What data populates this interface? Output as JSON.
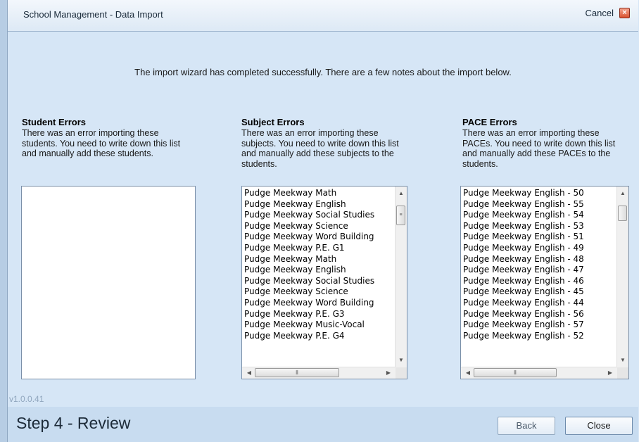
{
  "window": {
    "title": "School Management - Data Import",
    "cancel_label": "Cancel"
  },
  "message": "The import wizard has completed successfully. There are a few notes about the import below.",
  "student_errors": {
    "title": "Student Errors",
    "description": "There was an error importing these students. You need to write down this list and manually add these students.",
    "items": []
  },
  "subject_errors": {
    "title": "Subject Errors",
    "description": "There was an error importing these subjects. You need to write down this list and manually add these subjects to the students.",
    "items": [
      "Pudge Meekway Math",
      "Pudge Meekway English",
      "Pudge Meekway Social Studies",
      "Pudge Meekway Science",
      "Pudge Meekway Word Building",
      "Pudge Meekway P.E. G1",
      "Pudge Meekway Math",
      "Pudge Meekway English",
      "Pudge Meekway Social Studies",
      "Pudge Meekway Science",
      "Pudge Meekway Word Building",
      "Pudge Meekway P.E. G3",
      "Pudge Meekway Music-Vocal",
      "Pudge Meekway P.E. G4"
    ]
  },
  "pace_errors": {
    "title": "PACE Errors",
    "description": "There was an error importing these PACEs. You need to write down this list and manually add these PACEs to the students.",
    "items": [
      "Pudge Meekway English - 50",
      "Pudge Meekway English - 55",
      "Pudge Meekway English - 54",
      "Pudge Meekway English - 53",
      "Pudge Meekway English - 51",
      "Pudge Meekway English - 49",
      "Pudge Meekway English - 48",
      "Pudge Meekway English - 47",
      "Pudge Meekway English - 46",
      "Pudge Meekway English - 45",
      "Pudge Meekway English - 44",
      "Pudge Meekway English - 56",
      "Pudge Meekway English - 57",
      "Pudge Meekway English - 52"
    ]
  },
  "version": "v1.0.0.41",
  "footer": {
    "step_title": "Step 4 - Review",
    "back_label": "Back",
    "close_label": "Close"
  },
  "icons": {
    "cancel": "close-icon",
    "scroll_up": "scroll-up-arrow-icon",
    "scroll_down": "scroll-down-arrow-icon",
    "scroll_left": "scroll-left-arrow-icon",
    "scroll_right": "scroll-right-arrow-icon"
  }
}
